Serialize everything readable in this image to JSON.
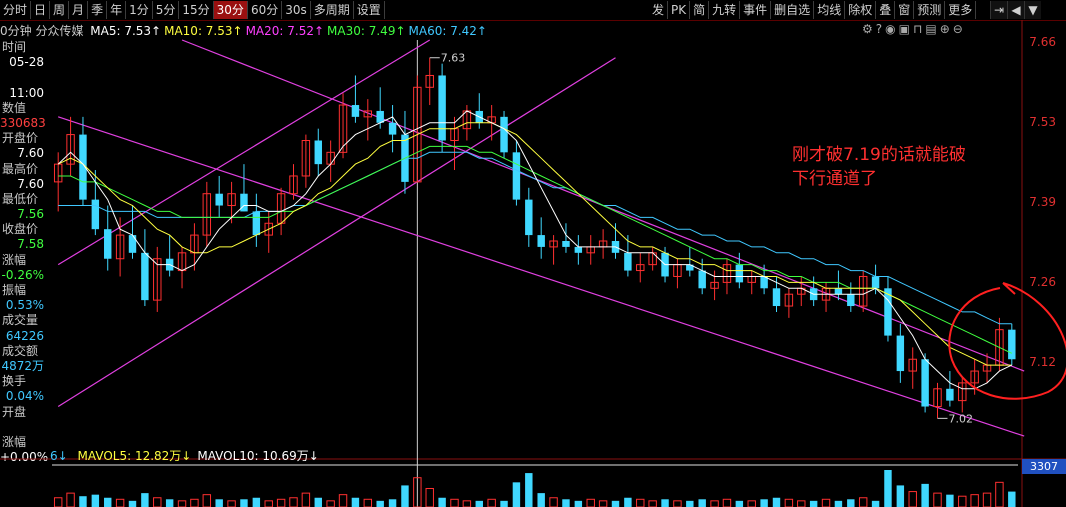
{
  "toolbar": {
    "left_items": [
      "分时",
      "日",
      "周",
      "月",
      "季",
      "年",
      "1分",
      "5分",
      "15分",
      "30分",
      "60分",
      "30s",
      "多周期",
      "设置"
    ],
    "active": "30分",
    "right_items": [
      "发",
      "PK",
      "简",
      "九转",
      "事件",
      "删自选",
      "均线",
      "除权",
      "叠",
      "窗",
      "预测",
      "更多"
    ]
  },
  "ma_header": {
    "label": "0分钟 分众传媒",
    "items": [
      {
        "text": "MA5: 7.53↑",
        "color": "#ffffff"
      },
      {
        "text": "MA10: 7.53↑",
        "color": "#ffff40"
      },
      {
        "text": "MA20: 7.52↑",
        "color": "#ff40ff"
      },
      {
        "text": "MA30: 7.49↑",
        "color": "#40ff40"
      },
      {
        "text": "MA60: 7.42↑",
        "color": "#40c8ff"
      }
    ]
  },
  "left_panel": [
    {
      "label": "时间",
      "value": "05-28"
    },
    {
      "label": "",
      "value": "11:00"
    },
    {
      "label": "数值",
      "value": "330683",
      "color": "#ff4040"
    },
    {
      "label": "开盘价",
      "value": "7.60"
    },
    {
      "label": "最高价",
      "value": "7.60"
    },
    {
      "label": "最低价",
      "value": "7.56",
      "color": "#40ff40"
    },
    {
      "label": "收盘价",
      "value": "7.58",
      "color": "#40ff40"
    },
    {
      "label": "涨幅",
      "value": "-0.26%",
      "color": "#40ff40"
    },
    {
      "label": "振幅",
      "value": "0.53%",
      "color": "#40c8ff"
    },
    {
      "label": "成交量",
      "value": "64226",
      "color": "#40c8ff"
    },
    {
      "label": "成交额",
      "value": "4872万",
      "color": "#40c8ff"
    },
    {
      "label": "换手",
      "value": "0.04%",
      "color": "#40c8ff"
    },
    {
      "label": "开盘",
      "value": ""
    },
    {
      "label": "涨幅",
      "value": "+0.00%"
    }
  ],
  "vol_header": {
    "prefix": "6↓",
    "items": [
      {
        "text": "MAVOL5: 12.82万↓",
        "color": "#ffff40"
      },
      {
        "text": "MAVOL10: 10.69万↓",
        "color": "#ffffff"
      }
    ]
  },
  "volume_readout": "3307",
  "annotation": {
    "line1": "刚才破7.19的话就能破",
    "line2": "下行通道了",
    "color": "#ff3030"
  },
  "chart_data": {
    "type": "candlestick",
    "title": "分众传媒 30分钟",
    "y_ticks": [
      "7.66",
      "7.53",
      "7.39",
      "7.26",
      "7.12"
    ],
    "ylim": [
      6.98,
      7.66
    ],
    "high_marker": "7.63",
    "low_marker": "7.02",
    "ohlc": [
      [
        7.42,
        7.47,
        7.37,
        7.45
      ],
      [
        7.45,
        7.53,
        7.43,
        7.5
      ],
      [
        7.5,
        7.53,
        7.38,
        7.39
      ],
      [
        7.39,
        7.44,
        7.33,
        7.34
      ],
      [
        7.34,
        7.38,
        7.27,
        7.29
      ],
      [
        7.29,
        7.36,
        7.26,
        7.33
      ],
      [
        7.33,
        7.38,
        7.29,
        7.3
      ],
      [
        7.3,
        7.34,
        7.21,
        7.22
      ],
      [
        7.22,
        7.31,
        7.2,
        7.29
      ],
      [
        7.29,
        7.33,
        7.26,
        7.27
      ],
      [
        7.27,
        7.31,
        7.24,
        7.3
      ],
      [
        7.3,
        7.35,
        7.27,
        7.33
      ],
      [
        7.33,
        7.42,
        7.31,
        7.4
      ],
      [
        7.4,
        7.43,
        7.36,
        7.38
      ],
      [
        7.38,
        7.42,
        7.35,
        7.4
      ],
      [
        7.4,
        7.45,
        7.37,
        7.37
      ],
      [
        7.37,
        7.4,
        7.31,
        7.33
      ],
      [
        7.33,
        7.37,
        7.3,
        7.35
      ],
      [
        7.35,
        7.41,
        7.33,
        7.4
      ],
      [
        7.4,
        7.45,
        7.39,
        7.43
      ],
      [
        7.43,
        7.5,
        7.41,
        7.49
      ],
      [
        7.49,
        7.51,
        7.43,
        7.45
      ],
      [
        7.45,
        7.49,
        7.42,
        7.47
      ],
      [
        7.47,
        7.57,
        7.46,
        7.55
      ],
      [
        7.55,
        7.6,
        7.52,
        7.53
      ],
      [
        7.53,
        7.56,
        7.49,
        7.54
      ],
      [
        7.54,
        7.58,
        7.51,
        7.52
      ],
      [
        7.52,
        7.55,
        7.47,
        7.5
      ],
      [
        7.5,
        7.54,
        7.4,
        7.42
      ],
      [
        7.42,
        7.6,
        7.42,
        7.58
      ],
      [
        7.58,
        7.63,
        7.55,
        7.6
      ],
      [
        7.6,
        7.62,
        7.47,
        7.49
      ],
      [
        7.49,
        7.53,
        7.44,
        7.51
      ],
      [
        7.51,
        7.55,
        7.49,
        7.54
      ],
      [
        7.54,
        7.57,
        7.51,
        7.52
      ],
      [
        7.52,
        7.55,
        7.49,
        7.53
      ],
      [
        7.53,
        7.54,
        7.46,
        7.47
      ],
      [
        7.47,
        7.49,
        7.38,
        7.39
      ],
      [
        7.39,
        7.41,
        7.31,
        7.33
      ],
      [
        7.33,
        7.36,
        7.29,
        7.31
      ],
      [
        7.31,
        7.33,
        7.28,
        7.32
      ],
      [
        7.32,
        7.35,
        7.3,
        7.31
      ],
      [
        7.31,
        7.33,
        7.28,
        7.3
      ],
      [
        7.3,
        7.33,
        7.28,
        7.31
      ],
      [
        7.31,
        7.34,
        7.29,
        7.32
      ],
      [
        7.32,
        7.35,
        7.29,
        7.3
      ],
      [
        7.3,
        7.33,
        7.26,
        7.27
      ],
      [
        7.27,
        7.3,
        7.25,
        7.28
      ],
      [
        7.28,
        7.31,
        7.27,
        7.3
      ],
      [
        7.3,
        7.31,
        7.25,
        7.26
      ],
      [
        7.26,
        7.29,
        7.24,
        7.28
      ],
      [
        7.28,
        7.31,
        7.26,
        7.27
      ],
      [
        7.27,
        7.29,
        7.23,
        7.24
      ],
      [
        7.24,
        7.27,
        7.22,
        7.25
      ],
      [
        7.25,
        7.29,
        7.23,
        7.28
      ],
      [
        7.28,
        7.3,
        7.24,
        7.25
      ],
      [
        7.25,
        7.27,
        7.23,
        7.26
      ],
      [
        7.26,
        7.28,
        7.23,
        7.24
      ],
      [
        7.24,
        7.26,
        7.2,
        7.21
      ],
      [
        7.21,
        7.24,
        7.19,
        7.23
      ],
      [
        7.23,
        7.26,
        7.21,
        7.24
      ],
      [
        7.24,
        7.26,
        7.21,
        7.22
      ],
      [
        7.22,
        7.25,
        7.2,
        7.24
      ],
      [
        7.24,
        7.27,
        7.22,
        7.23
      ],
      [
        7.23,
        7.25,
        7.2,
        7.21
      ],
      [
        7.21,
        7.27,
        7.2,
        7.26
      ],
      [
        7.26,
        7.28,
        7.23,
        7.24
      ],
      [
        7.24,
        7.26,
        7.15,
        7.16
      ],
      [
        7.16,
        7.18,
        7.08,
        7.1
      ],
      [
        7.1,
        7.14,
        7.07,
        7.12
      ],
      [
        7.12,
        7.13,
        7.03,
        7.04
      ],
      [
        7.04,
        7.08,
        7.02,
        7.07
      ],
      [
        7.07,
        7.1,
        7.04,
        7.05
      ],
      [
        7.05,
        7.09,
        7.03,
        7.08
      ],
      [
        7.08,
        7.12,
        7.06,
        7.1
      ],
      [
        7.1,
        7.13,
        7.08,
        7.11
      ],
      [
        7.11,
        7.19,
        7.1,
        7.17
      ],
      [
        7.17,
        7.18,
        7.11,
        7.12
      ]
    ],
    "ma5": [
      7.45,
      7.47,
      7.45,
      7.42,
      7.39,
      7.34,
      7.33,
      7.3,
      7.28,
      7.28,
      7.27,
      7.28,
      7.31,
      7.34,
      7.36,
      7.38,
      7.38,
      7.37,
      7.37,
      7.38,
      7.4,
      7.43,
      7.45,
      7.48,
      7.5,
      7.51,
      7.52,
      7.53,
      7.5,
      7.51,
      7.52,
      7.52,
      7.52,
      7.54,
      7.53,
      7.52,
      7.51,
      7.49,
      7.45,
      7.41,
      7.37,
      7.33,
      7.31,
      7.31,
      7.31,
      7.31,
      7.3,
      7.3,
      7.3,
      7.28,
      7.28,
      7.28,
      7.27,
      7.26,
      7.26,
      7.26,
      7.26,
      7.26,
      7.25,
      7.24,
      7.24,
      7.23,
      7.23,
      7.23,
      7.23,
      7.23,
      7.24,
      7.22,
      7.19,
      7.16,
      7.12,
      7.1,
      7.08,
      7.07,
      7.07,
      7.08,
      7.1,
      7.11
    ],
    "ma10": [
      7.45,
      7.46,
      7.45,
      7.43,
      7.41,
      7.39,
      7.38,
      7.36,
      7.34,
      7.33,
      7.31,
      7.3,
      7.3,
      7.31,
      7.31,
      7.32,
      7.33,
      7.34,
      7.35,
      7.37,
      7.38,
      7.4,
      7.41,
      7.43,
      7.45,
      7.46,
      7.48,
      7.49,
      7.49,
      7.5,
      7.51,
      7.51,
      7.51,
      7.52,
      7.52,
      7.52,
      7.51,
      7.5,
      7.48,
      7.46,
      7.44,
      7.42,
      7.4,
      7.38,
      7.36,
      7.34,
      7.32,
      7.31,
      7.31,
      7.3,
      7.29,
      7.29,
      7.28,
      7.28,
      7.27,
      7.27,
      7.27,
      7.26,
      7.26,
      7.25,
      7.25,
      7.25,
      7.24,
      7.24,
      7.24,
      7.24,
      7.24,
      7.23,
      7.22,
      7.2,
      7.18,
      7.16,
      7.14,
      7.13,
      7.12,
      7.11,
      7.11,
      7.11
    ],
    "ma30": [
      7.43,
      7.43,
      7.42,
      7.42,
      7.41,
      7.4,
      7.39,
      7.38,
      7.37,
      7.37,
      7.36,
      7.36,
      7.36,
      7.36,
      7.36,
      7.36,
      7.36,
      7.36,
      7.37,
      7.37,
      7.38,
      7.39,
      7.4,
      7.41,
      7.42,
      7.43,
      7.44,
      7.45,
      7.46,
      7.47,
      7.48,
      7.48,
      7.48,
      7.48,
      7.47,
      7.47,
      7.46,
      7.45,
      7.44,
      7.43,
      7.42,
      7.41,
      7.4,
      7.39,
      7.38,
      7.37,
      7.36,
      7.35,
      7.34,
      7.33,
      7.32,
      7.31,
      7.3,
      7.29,
      7.29,
      7.28,
      7.28,
      7.27,
      7.27,
      7.26,
      7.26,
      7.25,
      7.25,
      7.25,
      7.24,
      7.24,
      7.24,
      7.23,
      7.22,
      7.21,
      7.2,
      7.19,
      7.18,
      7.17,
      7.16,
      7.15,
      7.14,
      7.13
    ],
    "ma60": [
      7.38,
      7.38,
      7.38,
      7.38,
      7.37,
      7.37,
      7.37,
      7.37,
      7.36,
      7.36,
      7.36,
      7.36,
      7.36,
      7.36,
      7.36,
      7.36,
      7.37,
      7.37,
      7.37,
      7.38,
      7.38,
      7.39,
      7.4,
      7.41,
      7.42,
      7.43,
      7.44,
      7.45,
      7.46,
      7.46,
      7.47,
      7.47,
      7.47,
      7.47,
      7.46,
      7.46,
      7.45,
      7.44,
      7.43,
      7.42,
      7.41,
      7.41,
      7.4,
      7.39,
      7.38,
      7.38,
      7.37,
      7.36,
      7.36,
      7.35,
      7.34,
      7.34,
      7.33,
      7.33,
      7.32,
      7.32,
      7.31,
      7.31,
      7.3,
      7.3,
      7.29,
      7.29,
      7.28,
      7.28,
      7.27,
      7.27,
      7.26,
      7.26,
      7.25,
      7.24,
      7.23,
      7.22,
      7.21,
      7.2,
      7.2,
      7.19,
      7.18,
      7.18
    ],
    "volume": [
      6,
      9,
      7,
      8,
      6,
      5,
      4,
      9,
      6,
      5,
      4,
      5,
      8,
      5,
      4,
      5,
      6,
      4,
      5,
      6,
      9,
      6,
      4,
      8,
      6,
      5,
      4,
      5,
      14,
      19,
      12,
      6,
      5,
      4,
      4,
      5,
      4,
      16,
      22,
      9,
      6,
      5,
      4,
      5,
      4,
      4,
      6,
      5,
      4,
      5,
      4,
      4,
      5,
      4,
      5,
      4,
      4,
      5,
      6,
      5,
      4,
      4,
      5,
      4,
      5,
      6,
      4,
      24,
      14,
      10,
      15,
      9,
      8,
      7,
      8,
      9,
      16,
      10
    ],
    "channels": [
      {
        "color": "#e040e0",
        "points": [
          [
            0,
            7.28
          ],
          [
            30,
            7.66
          ]
        ]
      },
      {
        "color": "#e040e0",
        "points": [
          [
            0,
            7.04
          ],
          [
            45,
            7.63
          ]
        ]
      },
      {
        "color": "#e040e0",
        "points": [
          [
            10,
            7.66
          ],
          [
            78,
            7.1
          ]
        ]
      },
      {
        "color": "#e040e0",
        "points": [
          [
            0,
            7.53
          ],
          [
            78,
            6.99
          ]
        ]
      }
    ],
    "cursor_index": 29
  }
}
